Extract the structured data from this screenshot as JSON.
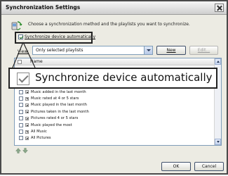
{
  "dialog": {
    "title": "Synchronization Settings",
    "instruction": "Choose a synchronization method and the playlists you want to synchronize.",
    "sync_auto_label": "Synchronize device automatically",
    "view_label": "View:",
    "view_value": "Only selected playlists",
    "new_button": "New",
    "edit_button": "Edit...",
    "list_header": "Name",
    "playlists": [
      "Music added in the last month",
      "Music rated at 4 or 5 stars",
      "Music played in the last month",
      "Pictures taken in the last month",
      "Pictures rated 4 or 5 stars",
      "Music played the most",
      "All Music",
      "All Pictures"
    ],
    "ok_button": "OK",
    "cancel_button": "Cancel"
  },
  "zoom_callout": {
    "label": "Synchronize device automatically"
  },
  "colors": {
    "callout_border": "#222222",
    "list_border": "#7f9db9",
    "dialog_bg": "#ecebe3"
  }
}
